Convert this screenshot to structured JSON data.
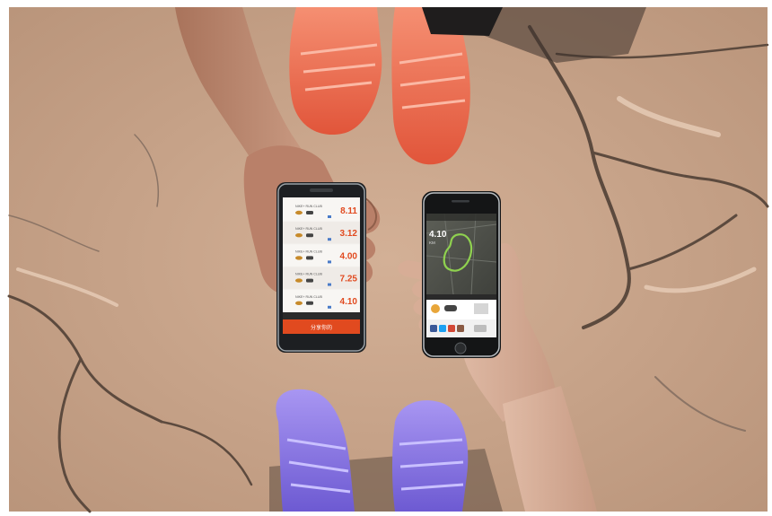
{
  "colors": {
    "ground": "#c9a68a",
    "ground_dark": "#a98a72",
    "crack": "#5c4a3e",
    "shoe_top": "#f26b4c",
    "shoe_bottom": "#8a78e6",
    "skin": "#c69277",
    "skin_dark": "#8f5f4a",
    "nike_orange": "#e14a1f",
    "map_green": "#8fd14f"
  },
  "left_phone": {
    "rows": [
      {
        "label": "NIKE+ RUN CLUB",
        "value": "8.11"
      },
      {
        "label": "NIKE+ RUN CLUB",
        "value": "3.12"
      },
      {
        "label": "NIKE+ RUN CLUB",
        "value": "4.00"
      },
      {
        "label": "NIKE+ RUN CLUB",
        "value": "7.25"
      },
      {
        "label": "NIKE+ RUN CLUB",
        "value": "4.10"
      }
    ],
    "button_label": "分享你的"
  },
  "right_phone": {
    "distance": "4.10",
    "unit": "KM"
  }
}
